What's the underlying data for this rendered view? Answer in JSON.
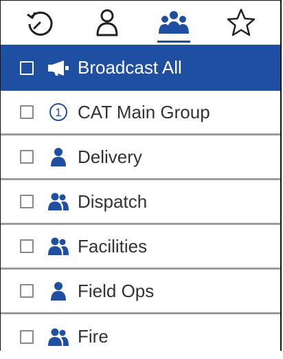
{
  "tabs": [
    {
      "name": "history",
      "icon": "history-icon",
      "active": false
    },
    {
      "name": "contacts",
      "icon": "person-icon",
      "active": false
    },
    {
      "name": "groups",
      "icon": "group-icon",
      "active": true
    },
    {
      "name": "favorites",
      "icon": "star-icon",
      "active": false
    }
  ],
  "items": [
    {
      "label": "Broadcast All",
      "icon": "megaphone-icon",
      "selected": true
    },
    {
      "label": "CAT Main Group",
      "icon": "number-one-icon",
      "badge": "1",
      "selected": false
    },
    {
      "label": "Delivery",
      "icon": "person-icon",
      "selected": false
    },
    {
      "label": "Dispatch",
      "icon": "group-icon",
      "selected": false
    },
    {
      "label": "Facilities",
      "icon": "group-icon",
      "selected": false
    },
    {
      "label": "Field Ops",
      "icon": "person-icon",
      "selected": false
    },
    {
      "label": "Fire",
      "icon": "group-icon",
      "selected": false
    }
  ],
  "colors": {
    "accent": "#1f4fa0",
    "divider": "#9b9b9b",
    "text": "#333333"
  }
}
